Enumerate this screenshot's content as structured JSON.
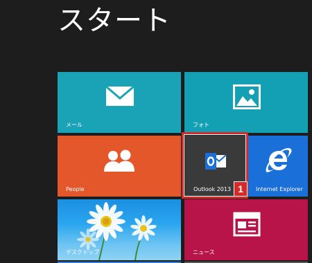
{
  "screen": {
    "title": "スタート"
  },
  "tiles": [
    {
      "id": "mail",
      "label": "メール",
      "icon": "mail-icon",
      "color": "#1aa3b6"
    },
    {
      "id": "photo",
      "label": "フォト",
      "icon": "photo-icon",
      "color": "#13a0b4"
    },
    {
      "id": "people",
      "label": "People",
      "icon": "people-icon",
      "color": "#e4572a"
    },
    {
      "id": "outlook",
      "label": "Outlook 2013",
      "icon": "outlook-icon",
      "color": "#3a3a3a"
    },
    {
      "id": "ie",
      "label": "Internet Explorer",
      "icon": "internet-explorer-icon",
      "color": "#1a6fd9"
    },
    {
      "id": "desktop",
      "label": "デスクトップ",
      "icon": "daisy-image",
      "color": "#2aa6ef"
    },
    {
      "id": "news",
      "label": "ニュース",
      "icon": "news-icon",
      "color": "#b8144a"
    }
  ],
  "callout": {
    "number": "1",
    "color": "#d42a2a"
  }
}
